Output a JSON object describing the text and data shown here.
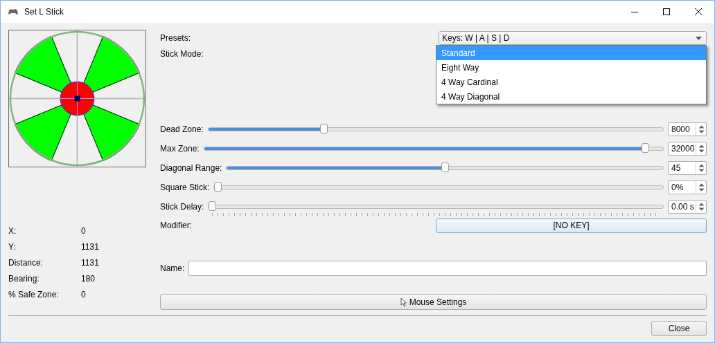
{
  "window": {
    "title": "Set L Stick"
  },
  "stats": [
    {
      "label": "X:",
      "value": "0"
    },
    {
      "label": "Y:",
      "value": "1131"
    },
    {
      "label": "Distance:",
      "value": "1131"
    },
    {
      "label": "Bearing:",
      "value": "180"
    },
    {
      "label": "% Safe Zone:",
      "value": "0"
    }
  ],
  "presets": {
    "label": "Presets:",
    "value": "Keys: W | A | S | D"
  },
  "stick_mode": {
    "label": "Stick Mode:",
    "expanded": true,
    "options": [
      {
        "label": "Standard",
        "selected": true
      },
      {
        "label": "Eight Way",
        "selected": false
      },
      {
        "label": "4 Way Cardinal",
        "selected": false
      },
      {
        "label": "4 Way Diagonal",
        "selected": false
      }
    ]
  },
  "sliders": [
    {
      "label": "Dead Zone:",
      "level": 0.25,
      "reading": "8000",
      "ticks": false
    },
    {
      "label": "Max Zone:",
      "level": 0.97,
      "reading": "32000",
      "ticks": false
    },
    {
      "label": "Diagonal Range:",
      "level": 0.5,
      "reading": "45",
      "ticks": false
    },
    {
      "label": "Square Stick:",
      "level": 0,
      "reading": "0%",
      "ticks": false
    },
    {
      "label": "Stick Delay:",
      "level": 0,
      "reading": "0.00 s",
      "ticks": true
    }
  ],
  "modifier": {
    "label": "Modifier:",
    "button": "[NO KEY]"
  },
  "name": {
    "label": "Name:"
  },
  "mouse_settings": "Mouse Settings",
  "close": "Close"
}
